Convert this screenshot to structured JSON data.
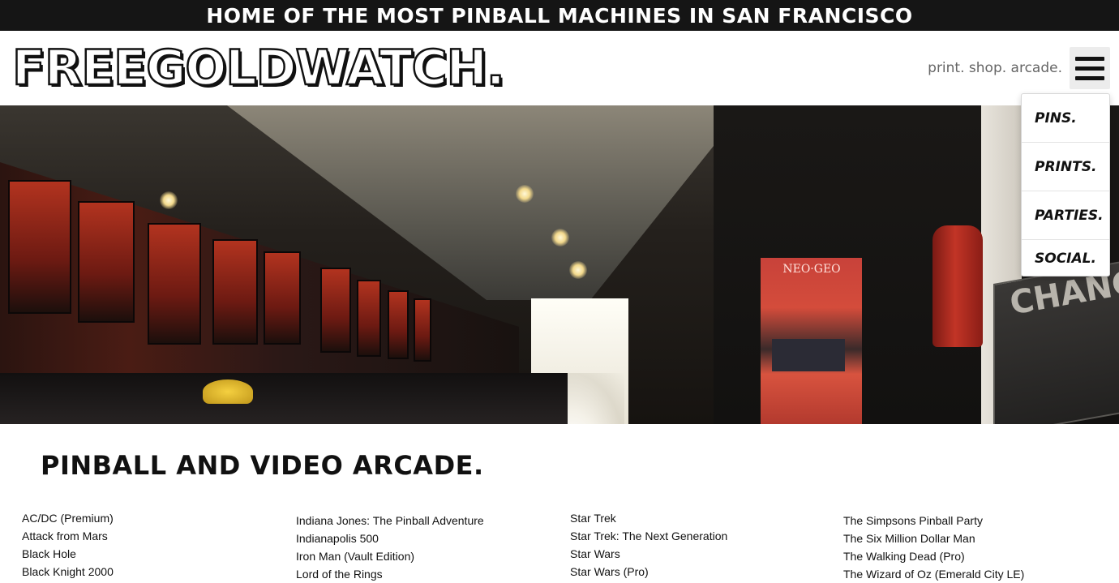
{
  "announcement": "HOME OF THE MOST PINBALL MACHINES IN SAN FRANCISCO",
  "header": {
    "logo": "FREEGOLDWATCH.",
    "tagline": "print. shop. arcade."
  },
  "menu": {
    "items": [
      {
        "label": "PINS."
      },
      {
        "label": "PRINTS."
      },
      {
        "label": "PARTIES."
      },
      {
        "label": "SOCIAL."
      }
    ]
  },
  "hero": {
    "neogeo_sign": "NEO·GEO",
    "change_sign": "CHANGE"
  },
  "section": {
    "title": "PINBALL AND VIDEO ARCADE."
  },
  "games": {
    "col1": [
      "AC/DC (Premium)",
      "Attack from Mars",
      "Black Hole",
      "Black Knight 2000"
    ],
    "col2": [
      "Indiana Jones: The Pinball Adventure",
      "Indianapolis 500",
      "Iron Man (Vault Edition)",
      "Lord of the Rings"
    ],
    "col3": [
      "Star Trek",
      "Star Trek: The Next Generation",
      "Star Wars",
      "Star Wars (Pro)"
    ],
    "col4": [
      "The Simpsons Pinball Party",
      "The Six Million Dollar Man",
      "The Walking Dead (Pro)",
      "The Wizard of Oz (Emerald City LE)"
    ]
  },
  "colors": {
    "announcement_bg": "#151515",
    "menu_button_bg": "#ececec",
    "tagline": "#666666"
  }
}
